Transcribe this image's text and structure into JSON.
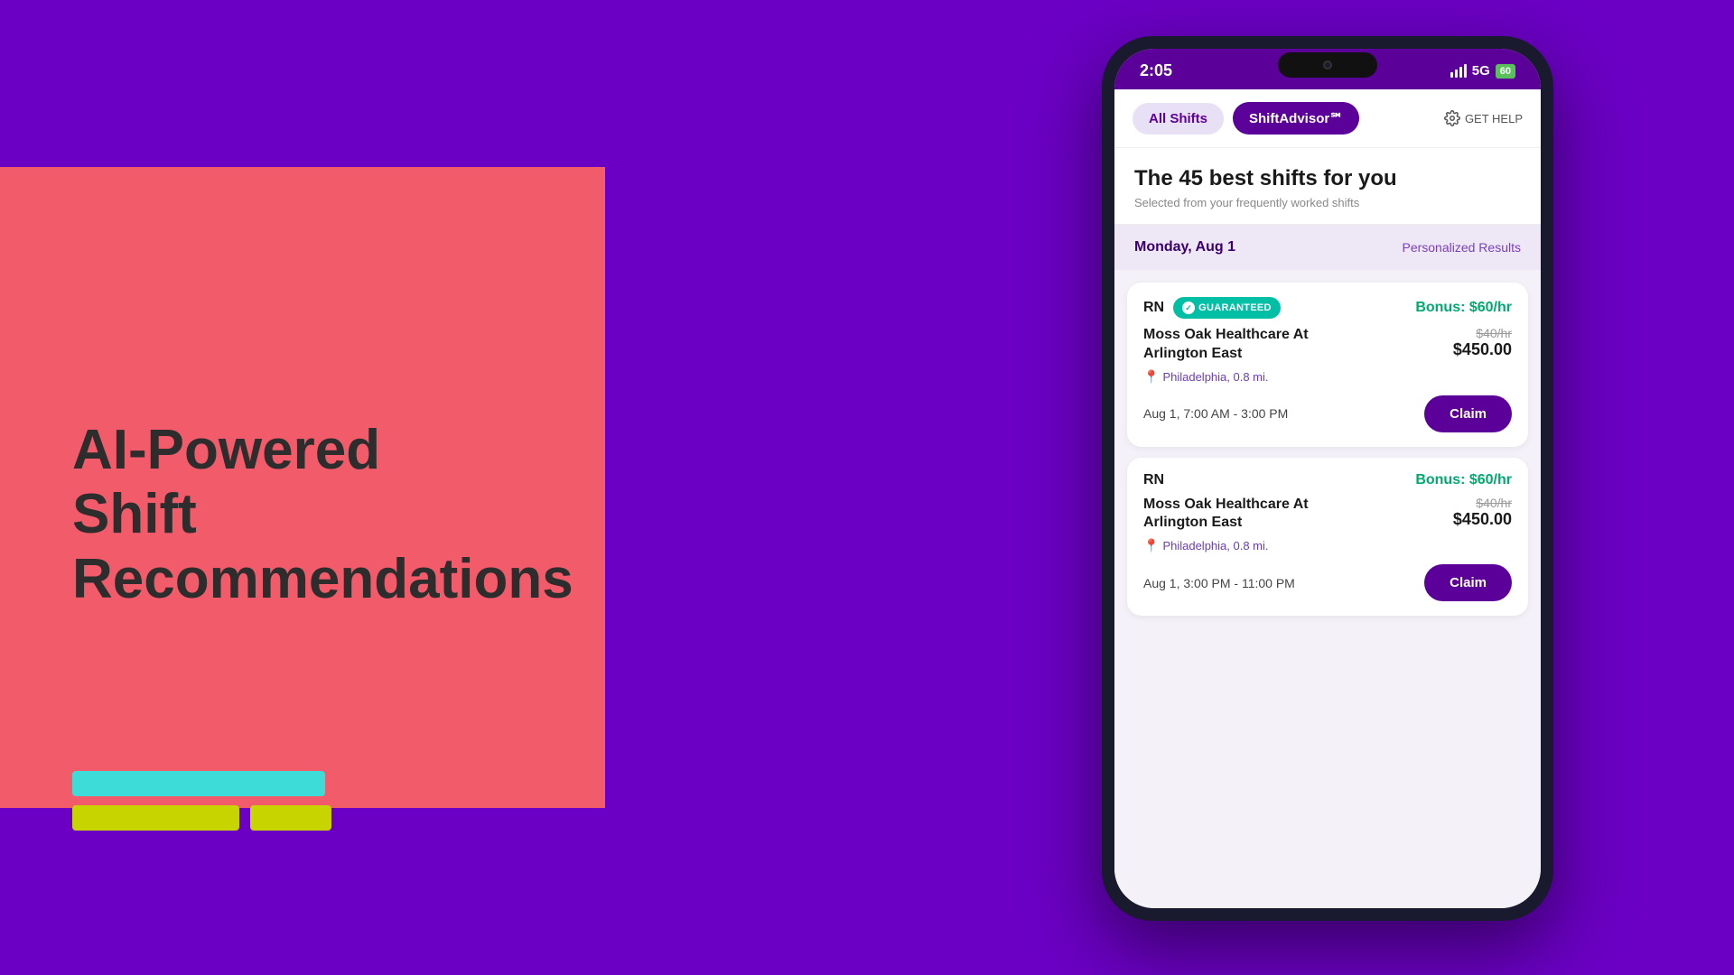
{
  "background": {
    "left_color": "#6B00C4",
    "coral_color": "#F25B6A"
  },
  "left_panel": {
    "headline_line1": "AI-Powered",
    "headline_line2": "Shift Recommendations"
  },
  "phone": {
    "status_bar": {
      "time": "2:05",
      "signal": "5G",
      "battery": "60"
    },
    "tabs": {
      "all_shifts": "All Shifts",
      "shift_advisor": "ShiftAdvisor℠",
      "get_help": "GET HELP"
    },
    "hero": {
      "title": "The 45 best shifts for you",
      "subtitle": "Selected from your frequently worked shifts"
    },
    "date_header": {
      "date": "Monday, Aug 1",
      "label": "Personalized Results"
    },
    "shifts": [
      {
        "role": "RN",
        "guaranteed": true,
        "guaranteed_label": "GUARANTEED",
        "bonus": "Bonus: $60/hr",
        "facility": "Moss Oak Healthcare At Arlington East",
        "location": "Philadelphia, 0.8 mi.",
        "original_price": "$40/hr",
        "final_price": "$450.00",
        "time": "Aug 1,  7:00 AM - 3:00 PM",
        "claim_label": "Claim"
      },
      {
        "role": "RN",
        "guaranteed": false,
        "guaranteed_label": "",
        "bonus": "Bonus: $60/hr",
        "facility": "Moss Oak Healthcare At Arlington East",
        "location": "Philadelphia, 0.8 mi.",
        "original_price": "$40/hr",
        "final_price": "$450.00",
        "time": "Aug 1,  3:00 PM - 11:00 PM",
        "claim_label": "Claim"
      }
    ]
  }
}
